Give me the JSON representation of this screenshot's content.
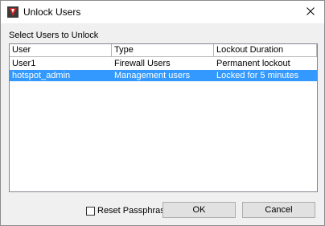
{
  "window": {
    "title": "Unlock Users"
  },
  "section_label": "Select Users to Unlock",
  "table": {
    "columns": [
      "User",
      "Type",
      "Lockout Duration"
    ],
    "rows": [
      {
        "user": "User1",
        "type": "Firewall Users",
        "duration": "Permanent lockout",
        "selected": false
      },
      {
        "user": "hotspot_admin",
        "type": "Management users",
        "duration": "Locked for 5 minutes",
        "selected": true
      }
    ]
  },
  "reset_passphrase": {
    "label": "Reset Passphrase",
    "checked": false
  },
  "buttons": {
    "ok": "OK",
    "cancel": "Cancel"
  },
  "colors": {
    "selection": "#3399ff",
    "dialog_bg": "#f0f0f0"
  }
}
